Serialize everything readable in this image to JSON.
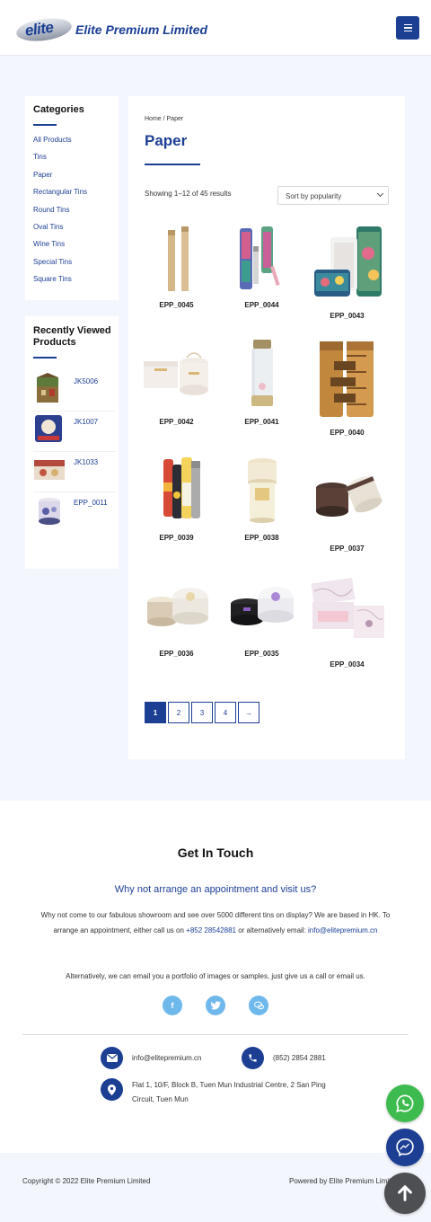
{
  "header": {
    "logo_word": "elite",
    "brand": "Elite Premium Limited"
  },
  "sidebar": {
    "categories_title": "Categories",
    "categories": [
      "All Products",
      "Tins",
      "Paper",
      "Rectangular Tins",
      "Round Tins",
      "Oval Tins",
      "Wine Tins",
      "Special Tins",
      "Square Tins"
    ],
    "recent_title": "Recently Viewed Products",
    "recent": [
      "JK5006",
      "JK1007",
      "JK1033",
      "EPP_0011"
    ]
  },
  "main": {
    "breadcrumb": "Home / Paper",
    "title": "Paper",
    "result_count": "Showing 1–12 of 45 results",
    "sort_selected": "Sort by popularity",
    "products": [
      "EPP_0045",
      "EPP_0044",
      "EPP_0043",
      "EPP_0042",
      "EPP_0041",
      "EPP_0040",
      "EPP_0039",
      "EPP_0038",
      "EPP_0037",
      "EPP_0036",
      "EPP_0035",
      "EPP_0034"
    ],
    "pagination": [
      "1",
      "2",
      "3",
      "4",
      "→"
    ]
  },
  "touch": {
    "title": "Get In Touch",
    "subtitle": "Why not arrange an appointment and visit us?",
    "para1_a": "Why not come to our fabulous showroom and see over 5000 different tins on display? We are based in HK. To arrange an appointment, either call us on ",
    "para1_phone": "+852 28542881",
    "para1_b": " or alternatively email: ",
    "para1_email": "info@elitepremium.cn",
    "para2": "Alternatively, we can email you a portfolio of images or samples, just give us a call or email us.",
    "email": "info@elitepremium.cn",
    "phone": "(852) 2854 2881",
    "address": "Flat 1, 10/F, Block B, Tuen Mun Industrial Centre, 2 San Ping Circuit, Tuen Mun"
  },
  "footer": {
    "copyright": "Copyright © 2022 Elite Premium Limited",
    "powered": "Powered by Elite Premium Limited"
  },
  "icons": {
    "facebook": "facebook-icon",
    "twitter": "twitter-icon",
    "chat": "chat-icon",
    "whatsapp": "whatsapp-icon",
    "messenger": "messenger-icon",
    "scroll_top": "arrow-up-icon"
  },
  "colors": {
    "brand": "#1c3f94",
    "social": "#6eb8ec",
    "whatsapp": "#3dbb4e",
    "messenger": "#1c3f94"
  }
}
